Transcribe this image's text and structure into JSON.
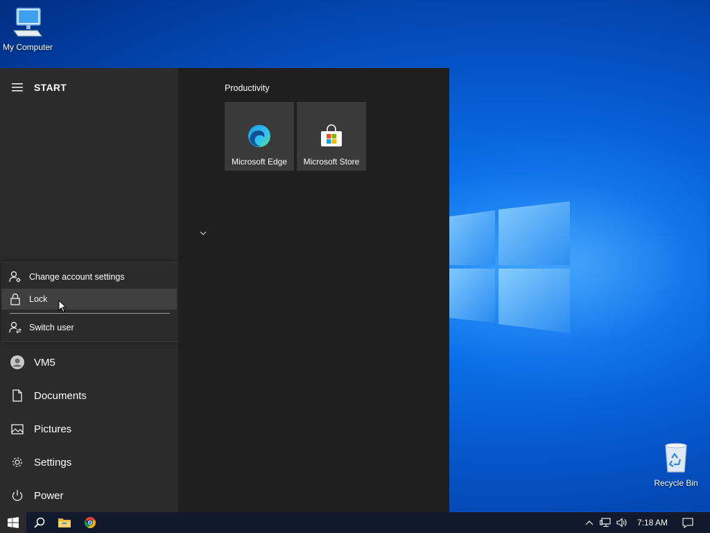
{
  "desktop": {
    "icons": [
      {
        "label": "My Computer"
      },
      {
        "label": "Recycle Bin"
      }
    ]
  },
  "start_menu": {
    "title": "START",
    "account_flyout": {
      "items": [
        {
          "label": "Change account settings",
          "icon": "account-settings-icon"
        },
        {
          "label": "Lock",
          "icon": "lock-icon"
        },
        {
          "label": "Switch user",
          "icon": "switch-user-icon"
        }
      ]
    },
    "left_items": [
      {
        "label": "VM5",
        "icon": "avatar"
      },
      {
        "label": "Documents",
        "icon": "document-icon"
      },
      {
        "label": "Pictures",
        "icon": "pictures-icon"
      },
      {
        "label": "Settings",
        "icon": "gear-icon"
      },
      {
        "label": "Power",
        "icon": "power-icon"
      }
    ],
    "tile_group": {
      "title": "Productivity",
      "tiles": [
        {
          "label": "Microsoft Edge",
          "icon": "edge-icon"
        },
        {
          "label": "Microsoft Store",
          "icon": "store-icon"
        }
      ]
    }
  },
  "taskbar": {
    "pinned": [
      {
        "icon": "windows-start-icon"
      },
      {
        "icon": "search-icon"
      },
      {
        "icon": "file-explorer-icon"
      },
      {
        "icon": "chrome-icon"
      }
    ],
    "tray": {
      "icons": [
        "chevron-up-icon",
        "network-icon",
        "volume-icon"
      ],
      "clock": "7:18 AM",
      "notification_icon": "action-center-icon"
    }
  },
  "colors": {
    "accent": "#0078d7",
    "start_left_bg": "#2b2b2b",
    "start_right_bg": "#1f1f1f",
    "tile_bg": "#3a3a3a",
    "taskbar_bg": "#101a2c"
  }
}
